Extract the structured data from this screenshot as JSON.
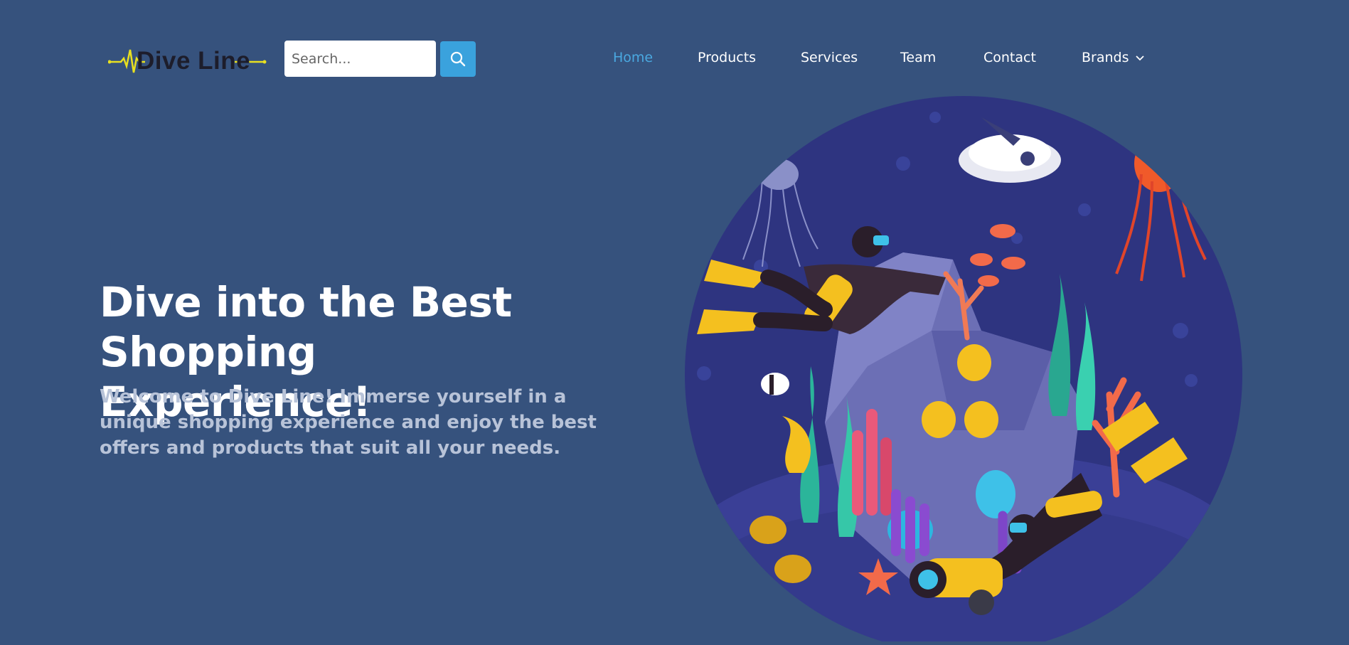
{
  "brand": {
    "name": "Dive Line",
    "logo_icon": "heartbeat-line-icon"
  },
  "search": {
    "placeholder": "Search...",
    "value": "",
    "button_icon": "search-icon"
  },
  "nav": {
    "items": [
      {
        "label": "Home",
        "active": true
      },
      {
        "label": "Products",
        "active": false
      },
      {
        "label": "Services",
        "active": false
      },
      {
        "label": "Team",
        "active": false
      },
      {
        "label": "Contact",
        "active": false
      },
      {
        "label": "Brands",
        "active": false,
        "icon": "chevron-down-icon"
      }
    ]
  },
  "hero": {
    "title_line1": "Dive into the Best Shopping",
    "title_line2": "Experience!",
    "description": "Welcome to Dive Line! Immerse yourself in a unique shopping experience and enjoy the best offers and products that suit all your needs.",
    "image": "underwater-divers-illustration"
  },
  "colors": {
    "background": "#36527d",
    "accent": "#3aa2dd",
    "active_nav": "#4aa8e0",
    "logo_line": "#e8e020",
    "circle": "#2e3480"
  }
}
